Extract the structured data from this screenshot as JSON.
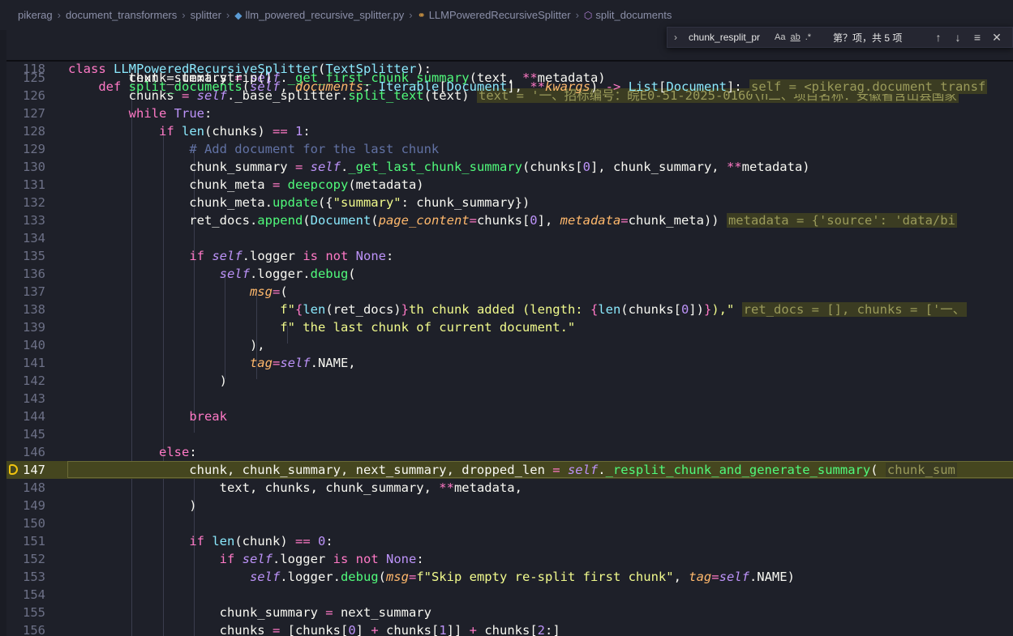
{
  "breadcrumb": {
    "items": [
      "pikerag",
      "document_transformers",
      "splitter",
      "llm_powered_recursive_splitter.py",
      "LLMPoweredRecursiveSplitter",
      "split_documents"
    ]
  },
  "find_widget": {
    "query": "chunk_resplit_pr",
    "match_case": "Aa",
    "whole_word": "ab",
    "regex": ".*",
    "result_count": "第？项，共 5 项"
  },
  "sticky": [
    {
      "num": "17",
      "text": "class LLMPoweredRecursiveSplitter(TextSplitter):"
    },
    {
      "num": "118",
      "text": "    def split_documents(self, documents: Iterable[Document], **kwargs) -> List[Document]:",
      "inline": "self = <pikerag.document_transf"
    }
  ],
  "partial_line": "        text = text.strip()",
  "lines": [
    {
      "num": "125",
      "text": "        chunk_summary = self._get_first_chunk_summary(text, **metadata)"
    },
    {
      "num": "126",
      "text": "        chunks = self._base_splitter.split_text(text)",
      "inline": "text = '一、招标编号：皖E0-51-2025-0160\\n二、项目名称：安徽省含山县国家"
    },
    {
      "num": "127",
      "text": "        while True:"
    },
    {
      "num": "128",
      "text": "            if len(chunks) == 1:"
    },
    {
      "num": "129",
      "text": "                # Add document for the last chunk"
    },
    {
      "num": "130",
      "text": "                chunk_summary = self._get_last_chunk_summary(chunks[0], chunk_summary, **metadata)"
    },
    {
      "num": "131",
      "text": "                chunk_meta = deepcopy(metadata)"
    },
    {
      "num": "132",
      "text": "                chunk_meta.update({\"summary\": chunk_summary})"
    },
    {
      "num": "133",
      "text": "                ret_docs.append(Document(page_content=chunks[0], metadata=chunk_meta))",
      "inline": "metadata = {'source': 'data/bi"
    },
    {
      "num": "134",
      "text": ""
    },
    {
      "num": "135",
      "text": "                if self.logger is not None:"
    },
    {
      "num": "136",
      "text": "                    self.logger.debug("
    },
    {
      "num": "137",
      "text": "                        msg=("
    },
    {
      "num": "138",
      "text": "                            f\"{len(ret_docs)}th chunk added (length: {len(chunks[0])}),\"",
      "inline": "ret_docs = [], chunks = ['一、"
    },
    {
      "num": "139",
      "text": "                            f\" the last chunk of current document.\""
    },
    {
      "num": "140",
      "text": "                        ),"
    },
    {
      "num": "141",
      "text": "                        tag=self.NAME,"
    },
    {
      "num": "142",
      "text": "                    )"
    },
    {
      "num": "143",
      "text": ""
    },
    {
      "num": "144",
      "text": "                break"
    },
    {
      "num": "145",
      "text": ""
    },
    {
      "num": "146",
      "text": "            else:"
    },
    {
      "num": "147",
      "text": "                chunk, chunk_summary, next_summary, dropped_len = self._resplit_chunk_and_generate_summary(",
      "inline": "chunk_sum",
      "active": true
    },
    {
      "num": "148",
      "text": "                    text, chunks, chunk_summary, **metadata,"
    },
    {
      "num": "149",
      "text": "                )"
    },
    {
      "num": "150",
      "text": ""
    },
    {
      "num": "151",
      "text": "                if len(chunk) == 0:"
    },
    {
      "num": "152",
      "text": "                    if self.logger is not None:"
    },
    {
      "num": "153",
      "text": "                        self.logger.debug(msg=f\"Skip empty re-split first chunk\", tag=self.NAME)"
    },
    {
      "num": "154",
      "text": ""
    },
    {
      "num": "155",
      "text": "                    chunk_summary = next_summary"
    },
    {
      "num": "156",
      "text": "                    chunks = [chunks[0] + chunks[1]] + chunks[2:]"
    }
  ],
  "colors": {
    "background": "#1e2029",
    "keyword": "#ff79c6",
    "class": "#8be9fd",
    "function": "#50fa7b",
    "self": "#bd93f9",
    "param": "#ffb86c",
    "string": "#f1fa8c",
    "comment": "#6272a4",
    "current_line": "#45461f"
  }
}
